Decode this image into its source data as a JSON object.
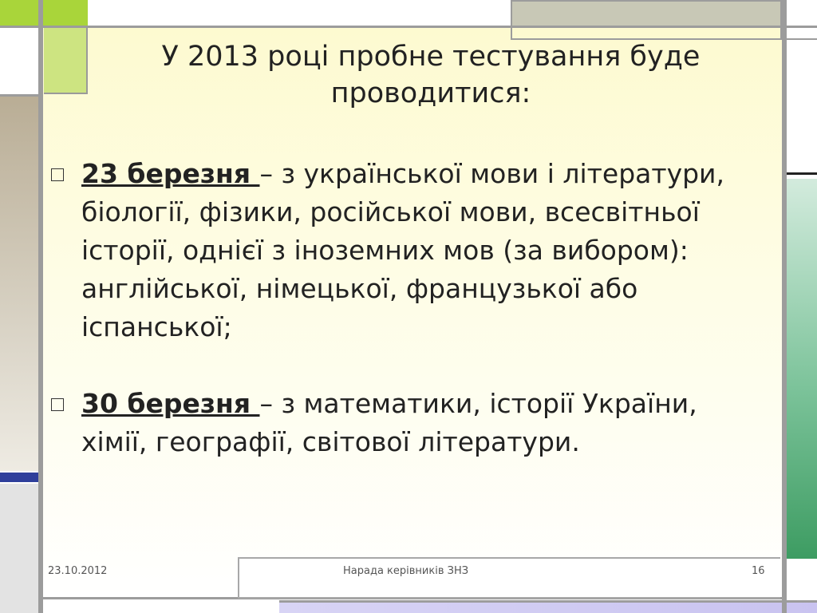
{
  "slide": {
    "title": "У 2013 році пробне тестування буде проводитися:",
    "bullets": [
      {
        "date": "23 березня ",
        "text": "– з української мови і літератури, біології, фізики, російської мови, всесвітньої історії, однієї з іноземних мов (за вибором): англійської, німецької, французької або іспанської;"
      },
      {
        "date": "30 березня ",
        "text": "– з математики, історії України, хімії, географії, світової літератури."
      }
    ]
  },
  "footer": {
    "date": "23.10.2012",
    "center": "Нарада керівників ЗНЗ",
    "page": "16"
  },
  "colors": {
    "accent_green": "#a9d53a",
    "panel_top": "#fdfad0",
    "frame_gray": "#9c9c9c",
    "right_green": "#3d9c62",
    "left_blue": "#2f3f9b"
  }
}
